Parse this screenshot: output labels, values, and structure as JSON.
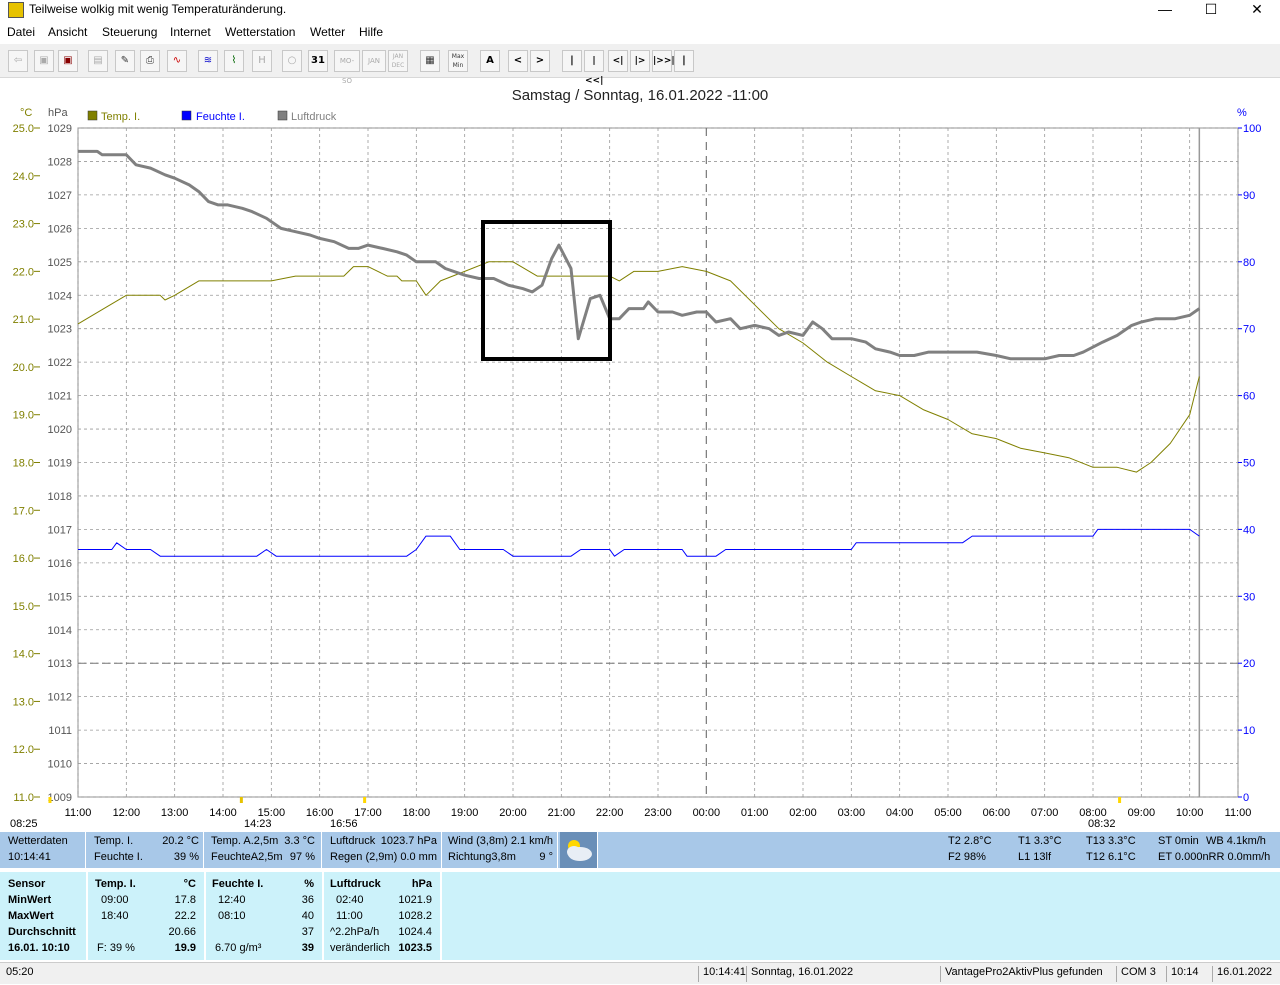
{
  "window": {
    "title": "Teilweise wolkig mit wenig Temperaturänderung.",
    "minimize": "—",
    "maximize": "☐",
    "close": "✕"
  },
  "menu": [
    "Datei",
    "Ansicht",
    "Steuerung",
    "Internet",
    "Wetterstation",
    "Wetter",
    "Hilfe"
  ],
  "toolbar": {
    "day_label": "31",
    "week_label": "MO-SO",
    "month_label": "JAN",
    "year_label": "JAN DEC",
    "minmax_label": "Max Min",
    "auto_label": "A",
    "prev_label": "<",
    "next_label": ">",
    "nav_first": "|",
    "nav_fast_back": "|<<|",
    "nav_back": "<|",
    "nav_fwd": "|>",
    "nav_fast_fwd": "|>>|",
    "nav_last": "|"
  },
  "chart": {
    "title": "Samstag / Sonntag, 16.01.2022  -11:00",
    "unit_c": "°C",
    "unit_hpa": "hPa",
    "unit_pct": "%",
    "legend": [
      {
        "name": "Temp. I.",
        "color": "#808000"
      },
      {
        "name": "Feuchte I.",
        "color": "#0000ff"
      },
      {
        "name": "Luftdruck",
        "color": "#808080"
      }
    ],
    "marker_labels": [
      "08:25",
      "14:23",
      "16:56",
      "08:32"
    ]
  },
  "chart_data": {
    "type": "line",
    "x_ticks": [
      "11:00",
      "12:00",
      "13:00",
      "14:00",
      "15:00",
      "16:00",
      "17:00",
      "18:00",
      "19:00",
      "20:00",
      "21:00",
      "22:00",
      "23:00",
      "00:00",
      "01:00",
      "02:00",
      "03:00",
      "04:00",
      "05:00",
      "06:00",
      "07:00",
      "08:00",
      "09:00",
      "10:00",
      "11:00"
    ],
    "xlim_hours": [
      0,
      24
    ],
    "y_left_c": {
      "ticks": [
        "11.0",
        "12.0",
        "13.0",
        "14.0",
        "15.0",
        "16.0",
        "17.0",
        "18.0",
        "19.0",
        "20.0",
        "21.0",
        "22.0",
        "23.0",
        "24.0",
        "25.0"
      ],
      "range": [
        11,
        25
      ]
    },
    "y_left_hpa": {
      "ticks": [
        "1009",
        "1010",
        "1011",
        "1012",
        "1013",
        "1014",
        "1015",
        "1016",
        "1017",
        "1018",
        "1019",
        "1020",
        "1021",
        "1022",
        "1023",
        "1024",
        "1025",
        "1026",
        "1027",
        "1028",
        "1029"
      ],
      "range": [
        1009,
        1029
      ]
    },
    "y_right_pct": {
      "ticks": [
        "0",
        "10",
        "20",
        "30",
        "40",
        "50",
        "60",
        "70",
        "80",
        "90",
        "100"
      ],
      "range": [
        0,
        100
      ]
    },
    "grid": true,
    "series": [
      {
        "name": "Temp. I.",
        "axis": "c",
        "color": "#808000",
        "points": [
          [
            0,
            20.9
          ],
          [
            0.5,
            21.2
          ],
          [
            1,
            21.5
          ],
          [
            1.7,
            21.5
          ],
          [
            1.8,
            21.4
          ],
          [
            2,
            21.5
          ],
          [
            2.5,
            21.8
          ],
          [
            4,
            21.8
          ],
          [
            4.5,
            21.9
          ],
          [
            5.5,
            21.9
          ],
          [
            5.7,
            22.1
          ],
          [
            6,
            22.1
          ],
          [
            6.4,
            21.9
          ],
          [
            6.6,
            21.9
          ],
          [
            6.7,
            21.8
          ],
          [
            7,
            21.8
          ],
          [
            7.2,
            21.5
          ],
          [
            7.5,
            21.8
          ],
          [
            8,
            22.0
          ],
          [
            8.5,
            22.2
          ],
          [
            9,
            22.2
          ],
          [
            9.5,
            21.9
          ],
          [
            10,
            21.9
          ],
          [
            11,
            21.9
          ],
          [
            11.2,
            21.8
          ],
          [
            11.5,
            22.0
          ],
          [
            12,
            22.0
          ],
          [
            12.5,
            22.1
          ],
          [
            13,
            22.0
          ],
          [
            13.5,
            21.8
          ],
          [
            14,
            21.3
          ],
          [
            14.5,
            20.8
          ],
          [
            15,
            20.5
          ],
          [
            15.5,
            20.1
          ],
          [
            16,
            19.8
          ],
          [
            16.5,
            19.5
          ],
          [
            17,
            19.4
          ],
          [
            17.5,
            19.1
          ],
          [
            18,
            18.9
          ],
          [
            18.5,
            18.6
          ],
          [
            19,
            18.5
          ],
          [
            19.5,
            18.3
          ],
          [
            20,
            18.2
          ],
          [
            20.5,
            18.1
          ],
          [
            21,
            17.9
          ],
          [
            21.5,
            17.9
          ],
          [
            21.9,
            17.8
          ],
          [
            22.2,
            18.0
          ],
          [
            22.6,
            18.4
          ],
          [
            23,
            19.0
          ],
          [
            23.2,
            19.8
          ]
        ]
      },
      {
        "name": "Feuchte I.",
        "axis": "pct",
        "color": "#0000ff",
        "points": [
          [
            0,
            37
          ],
          [
            0.7,
            37
          ],
          [
            0.8,
            38
          ],
          [
            1,
            37
          ],
          [
            1.5,
            37
          ],
          [
            1.7,
            36
          ],
          [
            3.7,
            36
          ],
          [
            3.9,
            37
          ],
          [
            4.1,
            36
          ],
          [
            6.8,
            36
          ],
          [
            7,
            37
          ],
          [
            7.2,
            39
          ],
          [
            7.7,
            39
          ],
          [
            7.9,
            37
          ],
          [
            8.8,
            37
          ],
          [
            9,
            36
          ],
          [
            10.2,
            36
          ],
          [
            10.4,
            37
          ],
          [
            11,
            37
          ],
          [
            11.1,
            36
          ],
          [
            11.3,
            37
          ],
          [
            12.5,
            37
          ],
          [
            12.6,
            36
          ],
          [
            13.2,
            36
          ],
          [
            13.4,
            37
          ],
          [
            16,
            37
          ],
          [
            16.1,
            38
          ],
          [
            18.3,
            38
          ],
          [
            18.5,
            39
          ],
          [
            21,
            39
          ],
          [
            21.1,
            40
          ],
          [
            23,
            40
          ],
          [
            23.2,
            39
          ]
        ]
      },
      {
        "name": "Luftdruck",
        "axis": "hpa",
        "color": "#808080",
        "points": [
          [
            0,
            1028.3
          ],
          [
            0.4,
            1028.3
          ],
          [
            0.5,
            1028.2
          ],
          [
            1,
            1028.2
          ],
          [
            1.2,
            1027.9
          ],
          [
            1.5,
            1027.8
          ],
          [
            1.8,
            1027.6
          ],
          [
            2,
            1027.5
          ],
          [
            2.3,
            1027.3
          ],
          [
            2.5,
            1027.1
          ],
          [
            2.7,
            1026.8
          ],
          [
            2.9,
            1026.7
          ],
          [
            3.1,
            1026.7
          ],
          [
            3.4,
            1026.6
          ],
          [
            3.6,
            1026.5
          ],
          [
            3.9,
            1026.3
          ],
          [
            4.2,
            1026.0
          ],
          [
            4.5,
            1025.9
          ],
          [
            4.8,
            1025.8
          ],
          [
            5,
            1025.7
          ],
          [
            5.3,
            1025.6
          ],
          [
            5.6,
            1025.4
          ],
          [
            5.8,
            1025.4
          ],
          [
            6,
            1025.5
          ],
          [
            6.3,
            1025.4
          ],
          [
            6.6,
            1025.3
          ],
          [
            6.8,
            1025.2
          ],
          [
            7,
            1025.0
          ],
          [
            7.4,
            1025.0
          ],
          [
            7.6,
            1024.8
          ],
          [
            8,
            1024.6
          ],
          [
            8.3,
            1024.5
          ],
          [
            8.6,
            1024.5
          ],
          [
            8.9,
            1024.3
          ],
          [
            9.2,
            1024.2
          ],
          [
            9.4,
            1024.1
          ],
          [
            9.6,
            1024.3
          ],
          [
            9.8,
            1025.1
          ],
          [
            9.95,
            1025.5
          ],
          [
            10.2,
            1024.8
          ],
          [
            10.35,
            1022.7
          ],
          [
            10.6,
            1023.9
          ],
          [
            10.8,
            1024.0
          ],
          [
            11,
            1023.3
          ],
          [
            11.2,
            1023.3
          ],
          [
            11.4,
            1023.6
          ],
          [
            11.7,
            1023.6
          ],
          [
            11.8,
            1023.8
          ],
          [
            12,
            1023.5
          ],
          [
            12.3,
            1023.5
          ],
          [
            12.5,
            1023.4
          ],
          [
            12.8,
            1023.5
          ],
          [
            13,
            1023.5
          ],
          [
            13.2,
            1023.2
          ],
          [
            13.5,
            1023.3
          ],
          [
            13.7,
            1023.0
          ],
          [
            14,
            1023.1
          ],
          [
            14.3,
            1023.0
          ],
          [
            14.5,
            1022.8
          ],
          [
            14.7,
            1022.9
          ],
          [
            15,
            1022.8
          ],
          [
            15.2,
            1023.2
          ],
          [
            15.4,
            1023.0
          ],
          [
            15.6,
            1022.7
          ],
          [
            16,
            1022.7
          ],
          [
            16.3,
            1022.6
          ],
          [
            16.5,
            1022.4
          ],
          [
            16.8,
            1022.3
          ],
          [
            17,
            1022.2
          ],
          [
            17.3,
            1022.2
          ],
          [
            17.6,
            1022.3
          ],
          [
            18,
            1022.3
          ],
          [
            18.3,
            1022.3
          ],
          [
            18.6,
            1022.3
          ],
          [
            19,
            1022.2
          ],
          [
            19.3,
            1022.1
          ],
          [
            19.6,
            1022.1
          ],
          [
            20,
            1022.1
          ],
          [
            20.3,
            1022.2
          ],
          [
            20.6,
            1022.2
          ],
          [
            20.8,
            1022.3
          ],
          [
            21.2,
            1022.6
          ],
          [
            21.5,
            1022.8
          ],
          [
            21.8,
            1023.1
          ],
          [
            22,
            1023.2
          ],
          [
            22.3,
            1023.3
          ],
          [
            22.7,
            1023.3
          ],
          [
            23,
            1023.4
          ],
          [
            23.2,
            1023.6
          ]
        ]
      }
    ]
  },
  "info": {
    "wetterdaten": "Wetterdaten",
    "time": "10:14:41",
    "temp_i_label": "Temp. I.",
    "temp_i_val": "20.2 °C",
    "feuchte_i_label": "Feuchte I.",
    "feuchte_i_val": "39 %",
    "temp_a_label": "Temp. A.2,5m",
    "temp_a_val": "3.3 °C",
    "feuchte_a_label": "FeuchteA2,5m",
    "feuchte_a_val": "97 %",
    "luftdruck_label": "Luftdruck",
    "luftdruck_val": "1023.7 hPa",
    "regen_label": "Regen (2,9m)",
    "regen_val": "0.0 mm",
    "wind_label": "Wind (3,8m)",
    "wind_val": "2.1 km/h",
    "richtung_label": "Richtung3,8m",
    "richtung_val": "9 °",
    "t2": "T2 2.8°C",
    "f2": "F2 98%",
    "t1": "T1 3.3°C",
    "l1": "L1 13lf",
    "t13": "T13 3.3°C",
    "t12": "T12 6.1°C",
    "st": "ST 0min",
    "wb": "WB 4.1km/h",
    "et": "ET 0.000nRR 0.0mm/h"
  },
  "stats": {
    "sensor": "Sensor",
    "minwert": "MinWert",
    "maxwert": "MaxWert",
    "durchschnitt": "Durchschnitt",
    "datetime": "16.01. 10:10",
    "temp_header": "Temp. I.",
    "temp_unit": "°C",
    "temp_min_time": "09:00",
    "temp_min": "17.8",
    "temp_max_time": "18:40",
    "temp_max": "22.2",
    "temp_avg": "20.66",
    "temp_f": "F: 39 %",
    "temp_now": "19.9",
    "feuchte_header": "Feuchte I.",
    "feuchte_unit": "%",
    "feuchte_min_time": "12:40",
    "feuchte_min": "36",
    "feuchte_max_time": "08:10",
    "feuchte_max": "40",
    "feuchte_avg": "37",
    "feuchte_abs": "6.70 g/m³",
    "feuchte_now": "39",
    "druck_header": "Luftdruck",
    "druck_unit": "hPa",
    "druck_min_time": "02:40",
    "druck_min": "1021.9",
    "druck_max_time": "11:00",
    "druck_max": "1028.2",
    "druck_trend": "^2.2hPa/h",
    "druck_avg": "1024.4",
    "druck_state": "veränderlich",
    "druck_now": "1023.5"
  },
  "status": {
    "s1": "05:20",
    "s2": "10:14:41",
    "s3": "Sonntag, 16.01.2022",
    "s4": "VantagePro2AktivPlus gefunden",
    "s5": "COM 3",
    "s6": "10:14",
    "s7": "16.01.2022"
  }
}
